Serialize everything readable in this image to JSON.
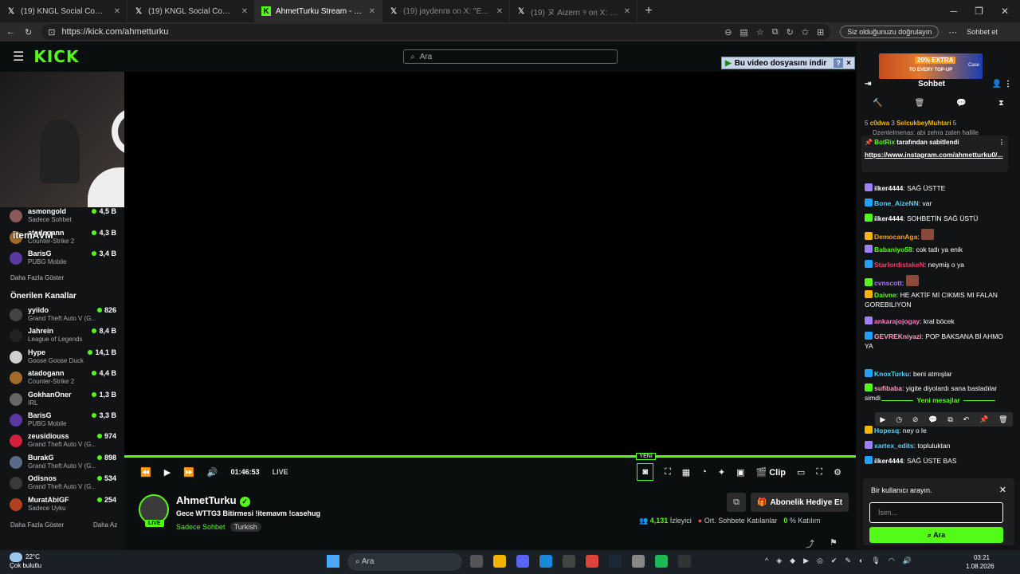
{
  "browser": {
    "tabs": [
      {
        "title": "(19) KNGL Social Community / X",
        "active": false
      },
      {
        "title": "(19) KNGL Social Community / X",
        "active": false
      },
      {
        "title": "AhmetTurku Stream - Watch Live o",
        "active": true
      },
      {
        "title": "(19) jaydenгв on X: \"Evleri yakın ol",
        "active": false
      },
      {
        "title": "(19) ヌ Aizerrı ୨ on X: \"yemek yap",
        "active": false
      }
    ],
    "url": "https://kick.com/ahmetturku",
    "sign_in_label": "Siz olduğunuzu doğrulayın",
    "sohbet_label": "Sohbet et"
  },
  "header": {
    "logo": "KICK",
    "search_placeholder": "Ara"
  },
  "download_bar": {
    "label": "Bu video dosyasını indir",
    "help": "?",
    "close": "×"
  },
  "sidebar": {
    "followed": [
      {
        "name": "asmongold",
        "game": "Sadece Sohbet",
        "viewers": "4,5 B",
        "color": "#8a5a5a"
      },
      {
        "name": "atadogann",
        "game": "Counter-Strike 2",
        "viewers": "4,3 B",
        "color": "#a36b2a"
      },
      {
        "name": "BarisG",
        "game": "PUBG Mobile",
        "viewers": "3,4 B",
        "color": "#5a3aa0"
      }
    ],
    "overlay_text": "itemAVM",
    "show_more_1": "Daha Fazla Göster",
    "recommended_title": "Önerilen Kanallar",
    "recommended": [
      {
        "name": "yyiido",
        "game": "Grand Theft Auto V (G...",
        "viewers": "826",
        "color": "#444"
      },
      {
        "name": "Jahrein",
        "game": "League of Legends",
        "viewers": "8,4 B",
        "color": "#222"
      },
      {
        "name": "Hype",
        "game": "Goose Goose Duck",
        "viewers": "14,1 B",
        "color": "#d0d0d0"
      },
      {
        "name": "atadogann",
        "game": "Counter-Strike 2",
        "viewers": "4,4 B",
        "color": "#a36b2a"
      },
      {
        "name": "GokhanOner",
        "game": "IRL",
        "viewers": "1,3 B",
        "color": "#666"
      },
      {
        "name": "BarisG",
        "game": "PUBG Mobile",
        "viewers": "3,3 B",
        "color": "#5a3aa0"
      },
      {
        "name": "zeusidiouss",
        "game": "Grand Theft Auto V (G...",
        "viewers": "974",
        "color": "#d0203a"
      },
      {
        "name": "BurakG",
        "game": "Grand Theft Auto V (G...",
        "viewers": "898",
        "color": "#5a6a8a"
      },
      {
        "name": "Odisnos",
        "game": "Grand Theft Auto V (G...",
        "viewers": "534",
        "color": "#3a3a3a"
      },
      {
        "name": "MuratAbiGF",
        "game": "Sadece Uyku",
        "viewers": "254",
        "color": "#b04020"
      }
    ],
    "show_more_2": "Daha Fazla Göster",
    "show_less": "Daha Az"
  },
  "player": {
    "time": "01:46:53",
    "live_label": "LIVE",
    "new_label": "YENİ",
    "clip_label": "Clip",
    "progress": 1.0
  },
  "stream": {
    "streamer": "AhmetTurku",
    "live_badge": "LIVE",
    "title": "Gece WTTG3 Bitirmesi !itemavm !casehug",
    "category": "Sadece Sohbet",
    "tag": "Turkish",
    "gift_label": "Abonelik Hediye Et",
    "viewers": "4,131",
    "viewers_label": "İzleyici",
    "avg_label": "Ort. Sohbete Katılanlar",
    "participation": "0",
    "participation_label": "% Katılım"
  },
  "chat": {
    "ad_line1": "20% EXTRA",
    "ad_line2": "TO EVERY TOP-UP",
    "ad_brand": "Case",
    "title": "Sohbet",
    "top_line_count1": "5",
    "top_line_user1": "c0dwa",
    "top_line_count2": "3",
    "top_line_user2": "SelcukbeyMuhtari",
    "top_line_count3": "5",
    "top_line_hidden": "Dzentelmenas: abi zehra zaten hallile",
    "pinned_by": "BotRix",
    "pinned_suffix": "tarafından sabitlendi",
    "pinned_link": "https://www.instagram.com/ahmetturku0/...",
    "messages": [
      {
        "user": "ilker4444",
        "text": "SAĞ ÜSTTE",
        "color": "#ffffff"
      },
      {
        "user": "Bone_AizeNN",
        "text": "var",
        "color": "#4fd1ff"
      },
      {
        "user": "ilker4444",
        "text": "SOHBETİN SAĞ ÜSTÜ",
        "color": "#ffffff"
      },
      {
        "user": "DemocanAga",
        "text": "",
        "color": "#f5a524"
      },
      {
        "user": "Babaniyo58",
        "text": "cok tatlı ya enik",
        "color": "#53fc18"
      },
      {
        "user": "StarlordistakeN",
        "text": "neymiş o ya",
        "color": "#ff3a6a"
      },
      {
        "user": "cvnscott",
        "text": "",
        "color": "#b07aff"
      },
      {
        "user": "Daivne",
        "text": "HE AKTİF Mİ CIKMIS MI FALAN GOREBILIYON",
        "color": "#53fc18"
      },
      {
        "user": "ankarajojogay",
        "text": "kral böcek",
        "color": "#ff77c8"
      },
      {
        "user": "GEVREKniyazi",
        "text": "POP BAKSANA Bİ AHMO YA",
        "color": "#ff9ebd"
      }
    ],
    "new_messages_label": "Yeni mesajlar",
    "new_messages": [
      {
        "user": "KnoxTurku",
        "text": "beni atmışlar",
        "color": "#4fd1ff"
      },
      {
        "user": "sufibaba",
        "text": "yigite diyolardı sana basladılar simdi",
        "color": "#ff9ebd"
      },
      {
        "user": "Hopesq",
        "text": "ney o le",
        "color": "#4fd1ff"
      },
      {
        "user": "xartex_edits",
        "text": "topluluktan",
        "color": "#4fd1ff"
      },
      {
        "user": "ilker4444",
        "text": "SAĞ ÜSTE BAS",
        "color": "#ffffff"
      }
    ],
    "user_search_label": "Bir kullanıcı arayın.",
    "user_search_placeholder": "İsim...",
    "user_search_button": "Ara"
  },
  "taskbar": {
    "temperature": "22°C",
    "weather": "Çok bulutlu",
    "search_placeholder": "Ara",
    "time": "03:21",
    "date": "1.08.2026"
  }
}
